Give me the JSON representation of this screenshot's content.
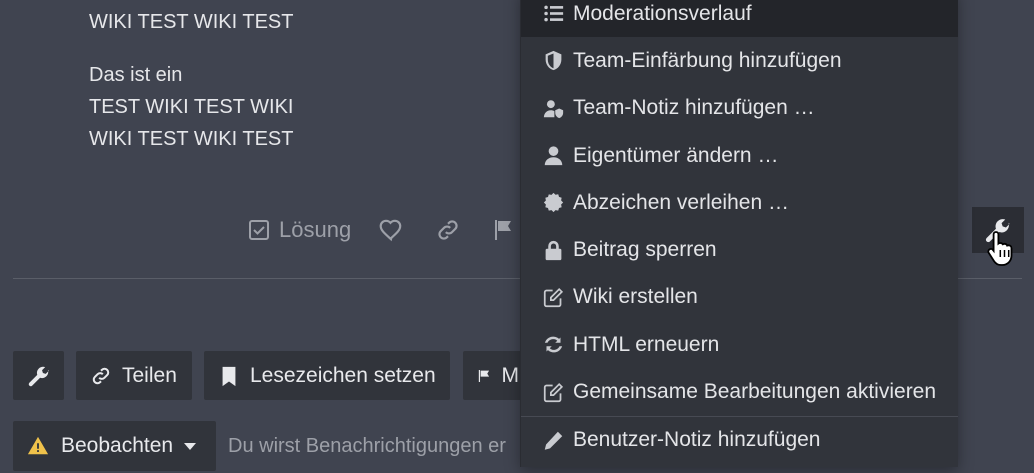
{
  "post": {
    "lines_top": [
      "WIKI TEST WIKI TEST"
    ],
    "lines_para": [
      "Das ist ein",
      "TEST WIKI TEST WIKI",
      "WIKI TEST WIKI TEST"
    ]
  },
  "post_actions": {
    "solution_label": "Lösung"
  },
  "menu": {
    "items": [
      {
        "label": "Moderationsverlauf",
        "icon": "list-icon"
      },
      {
        "label": "Team-Einfärbung hinzufügen",
        "icon": "shield-icon"
      },
      {
        "label": "Team-Notiz hinzufügen …",
        "icon": "user-shield-icon"
      },
      {
        "label": "Eigentümer ändern …",
        "icon": "user-icon"
      },
      {
        "label": "Abzeichen verleihen …",
        "icon": "certificate-icon"
      },
      {
        "label": "Beitrag sperren",
        "icon": "lock-icon"
      },
      {
        "label": "Wiki erstellen",
        "icon": "edit-icon"
      },
      {
        "label": "HTML erneuern",
        "icon": "sync-icon"
      },
      {
        "label": "Gemeinsame Bearbeitungen aktivieren",
        "icon": "edit-icon"
      },
      {
        "label": "Benutzer-Notiz hinzufügen",
        "icon": "pencil-icon"
      }
    ]
  },
  "topic_footer": {
    "share_label": "Teilen",
    "bookmark_label": "Lesezeichen setzen",
    "flag_label": "M",
    "watch_label": "Beobachten",
    "notification_text": "Du wirst Benachrichtigungen er"
  }
}
